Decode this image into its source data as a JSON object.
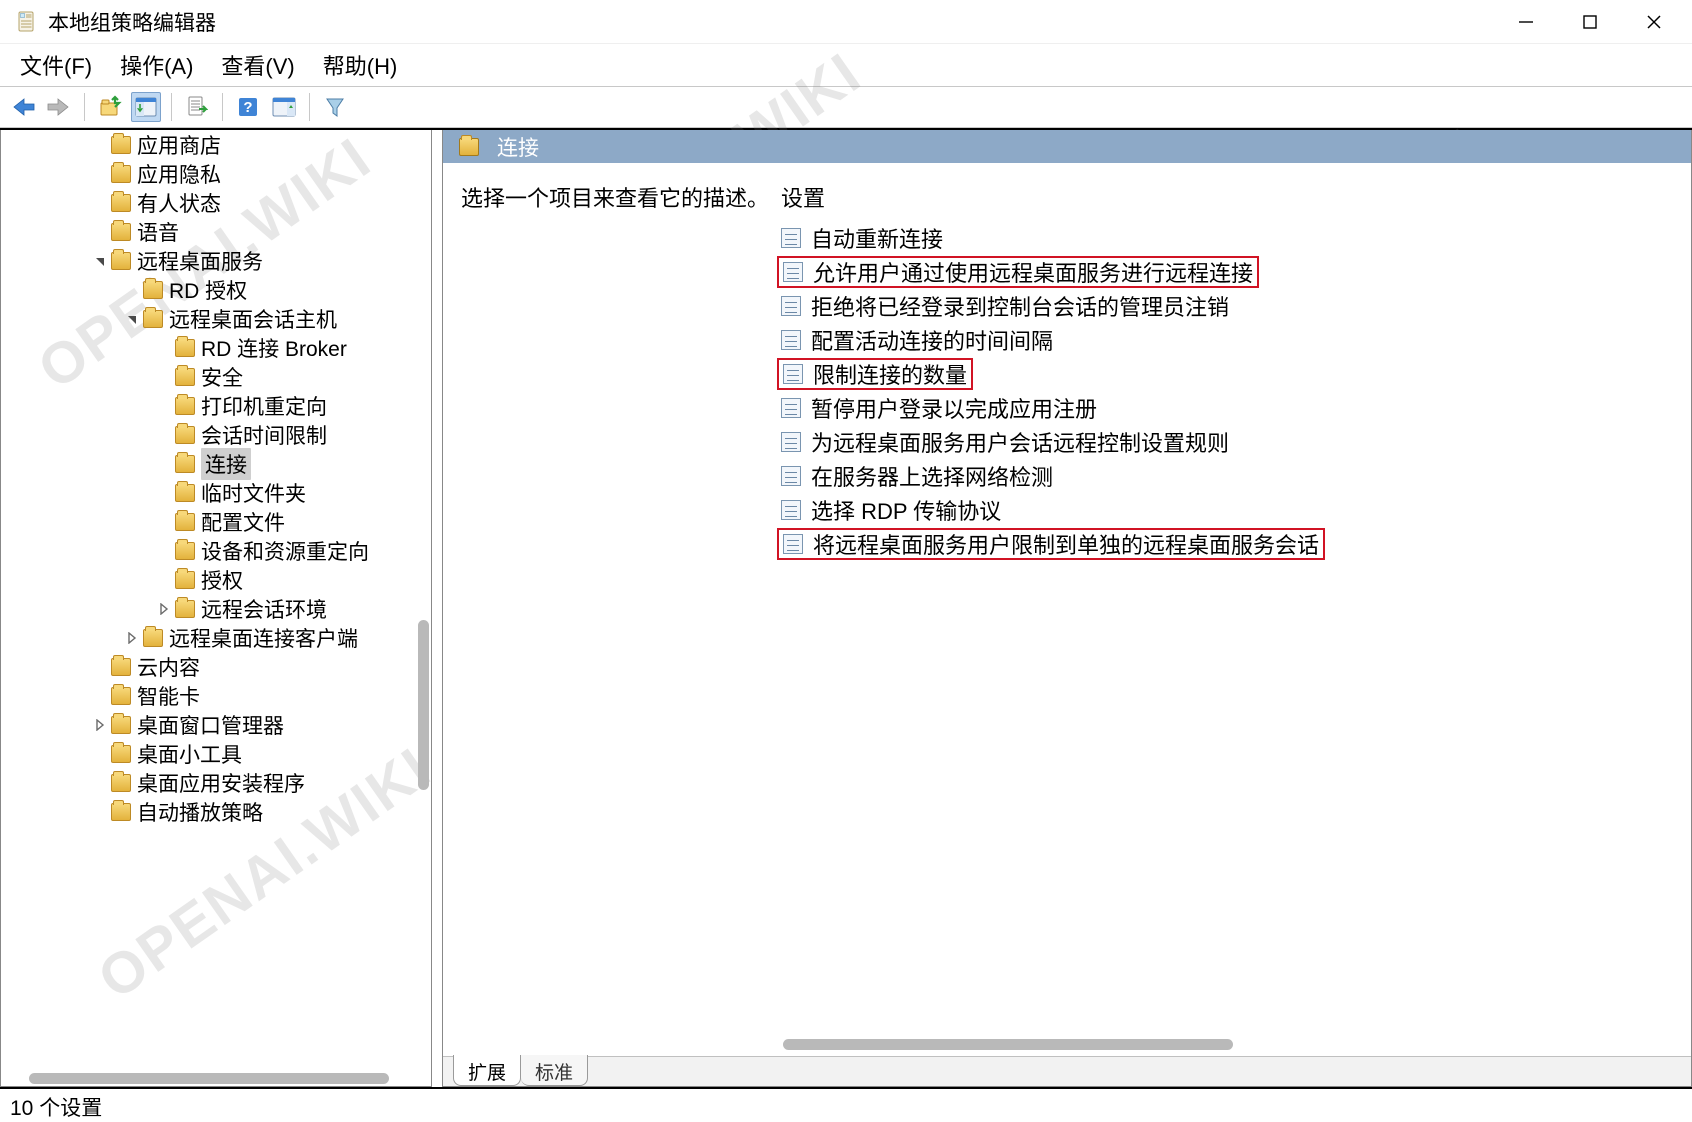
{
  "watermark": "OPENAI.WIKI",
  "window": {
    "title": "本地组策略编辑器"
  },
  "menu": {
    "file": "文件(F)",
    "action": "操作(A)",
    "view": "查看(V)",
    "help": "帮助(H)"
  },
  "tree": {
    "items": [
      {
        "depth": 0,
        "caret": "",
        "label": "应用商店"
      },
      {
        "depth": 0,
        "caret": "",
        "label": "应用隐私"
      },
      {
        "depth": 0,
        "caret": "",
        "label": "有人状态"
      },
      {
        "depth": 0,
        "caret": "",
        "label": "语音"
      },
      {
        "depth": 0,
        "caret": "down",
        "label": "远程桌面服务"
      },
      {
        "depth": 1,
        "caret": "",
        "label": "RD 授权"
      },
      {
        "depth": 1,
        "caret": "down",
        "label": "远程桌面会话主机"
      },
      {
        "depth": 2,
        "caret": "",
        "label": "RD 连接 Broker"
      },
      {
        "depth": 2,
        "caret": "",
        "label": "安全"
      },
      {
        "depth": 2,
        "caret": "",
        "label": "打印机重定向"
      },
      {
        "depth": 2,
        "caret": "",
        "label": "会话时间限制"
      },
      {
        "depth": 2,
        "caret": "",
        "label": "连接",
        "selected": true
      },
      {
        "depth": 2,
        "caret": "",
        "label": "临时文件夹"
      },
      {
        "depth": 2,
        "caret": "",
        "label": "配置文件"
      },
      {
        "depth": 2,
        "caret": "",
        "label": "设备和资源重定向"
      },
      {
        "depth": 2,
        "caret": "",
        "label": "授权"
      },
      {
        "depth": 2,
        "caret": "right",
        "label": "远程会话环境"
      },
      {
        "depth": 1,
        "caret": "right",
        "label": "远程桌面连接客户端"
      },
      {
        "depth": 0,
        "caret": "",
        "label": "云内容"
      },
      {
        "depth": 0,
        "caret": "",
        "label": "智能卡"
      },
      {
        "depth": 0,
        "caret": "right",
        "label": "桌面窗口管理器"
      },
      {
        "depth": 0,
        "caret": "",
        "label": "桌面小工具"
      },
      {
        "depth": 0,
        "caret": "",
        "label": "桌面应用安装程序"
      },
      {
        "depth": 0,
        "caret": "",
        "label": "自动播放策略"
      }
    ]
  },
  "right": {
    "header": "连接",
    "desc_prompt": "选择一个项目来查看它的描述。",
    "settings_header": "设置",
    "settings": [
      {
        "label": "自动重新连接",
        "hl": false
      },
      {
        "label": "允许用户通过使用远程桌面服务进行远程连接",
        "hl": true
      },
      {
        "label": "拒绝将已经登录到控制台会话的管理员注销",
        "hl": false
      },
      {
        "label": "配置活动连接的时间间隔",
        "hl": false
      },
      {
        "label": "限制连接的数量",
        "hl": true
      },
      {
        "label": "暂停用户登录以完成应用注册",
        "hl": false
      },
      {
        "label": "为远程桌面服务用户会话远程控制设置规则",
        "hl": false
      },
      {
        "label": "在服务器上选择网络检测",
        "hl": false
      },
      {
        "label": "选择 RDP 传输协议",
        "hl": false
      },
      {
        "label": "将远程桌面服务用户限制到单独的远程桌面服务会话",
        "hl": true
      }
    ]
  },
  "tabs": {
    "extended": "扩展",
    "standard": "标准"
  },
  "status": "10 个设置"
}
